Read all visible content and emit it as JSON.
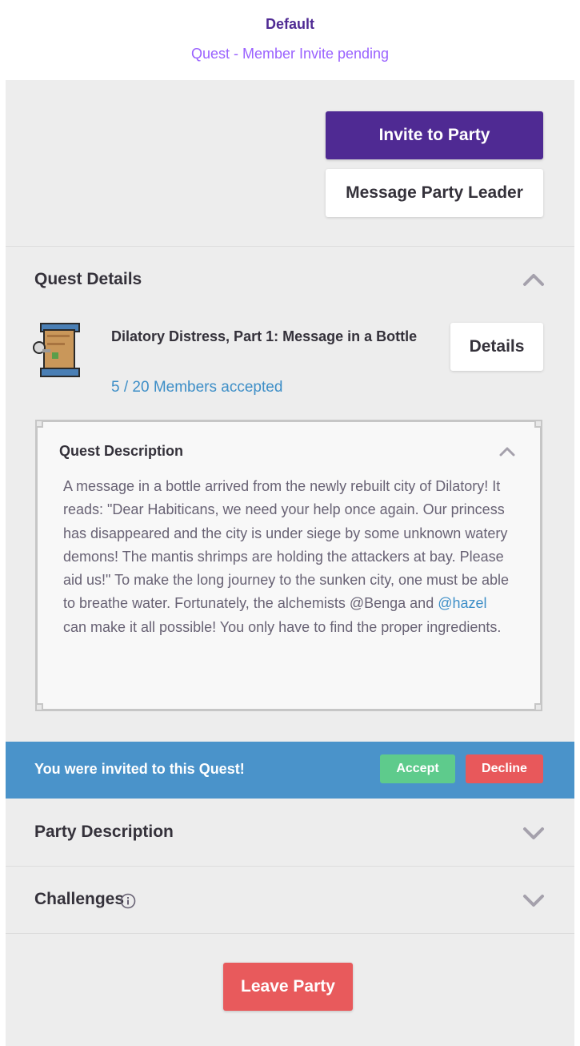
{
  "header": {
    "title": "Default",
    "subtitle": "Quest - Member Invite pending"
  },
  "actions": {
    "invite_label": "Invite to Party",
    "message_leader_label": "Message Party Leader"
  },
  "quest_details": {
    "title": "Quest Details",
    "quest_name": "Dilatory Distress, Part 1: Message in a Bottle",
    "members_accepted": "5 / 20 Members accepted",
    "details_label": "Details",
    "icon": "quest-scroll-icon"
  },
  "quest_description": {
    "title": "Quest Description",
    "text_before": "A message in a bottle arrived from the newly rebuilt city of Dilatory! It reads: \"Dear Habiticans, we need your help once again. Our princess has disappeared and the city is under siege by some unknown watery demons! The mantis shrimps are holding the attackers at bay. Please aid us!\" To make the long journey to the sunken city, one must be able to breathe water. Fortunately, the alchemists @Benga and ",
    "mention": "@hazel",
    "text_after": " can make it all possible! You only have to find the proper ingredients."
  },
  "invite_banner": {
    "text": "You were invited to this Quest!",
    "accept_label": "Accept",
    "decline_label": "Decline"
  },
  "party_description": {
    "title": "Party Description"
  },
  "challenges": {
    "title": "Challenges"
  },
  "leave_label": "Leave Party",
  "colors": {
    "brand_purple": "#4f2a93",
    "link_blue": "#3d8ec7",
    "banner_blue": "#4a93ca",
    "accept_green": "#5ecb8c",
    "danger_red": "#e85a5c"
  }
}
